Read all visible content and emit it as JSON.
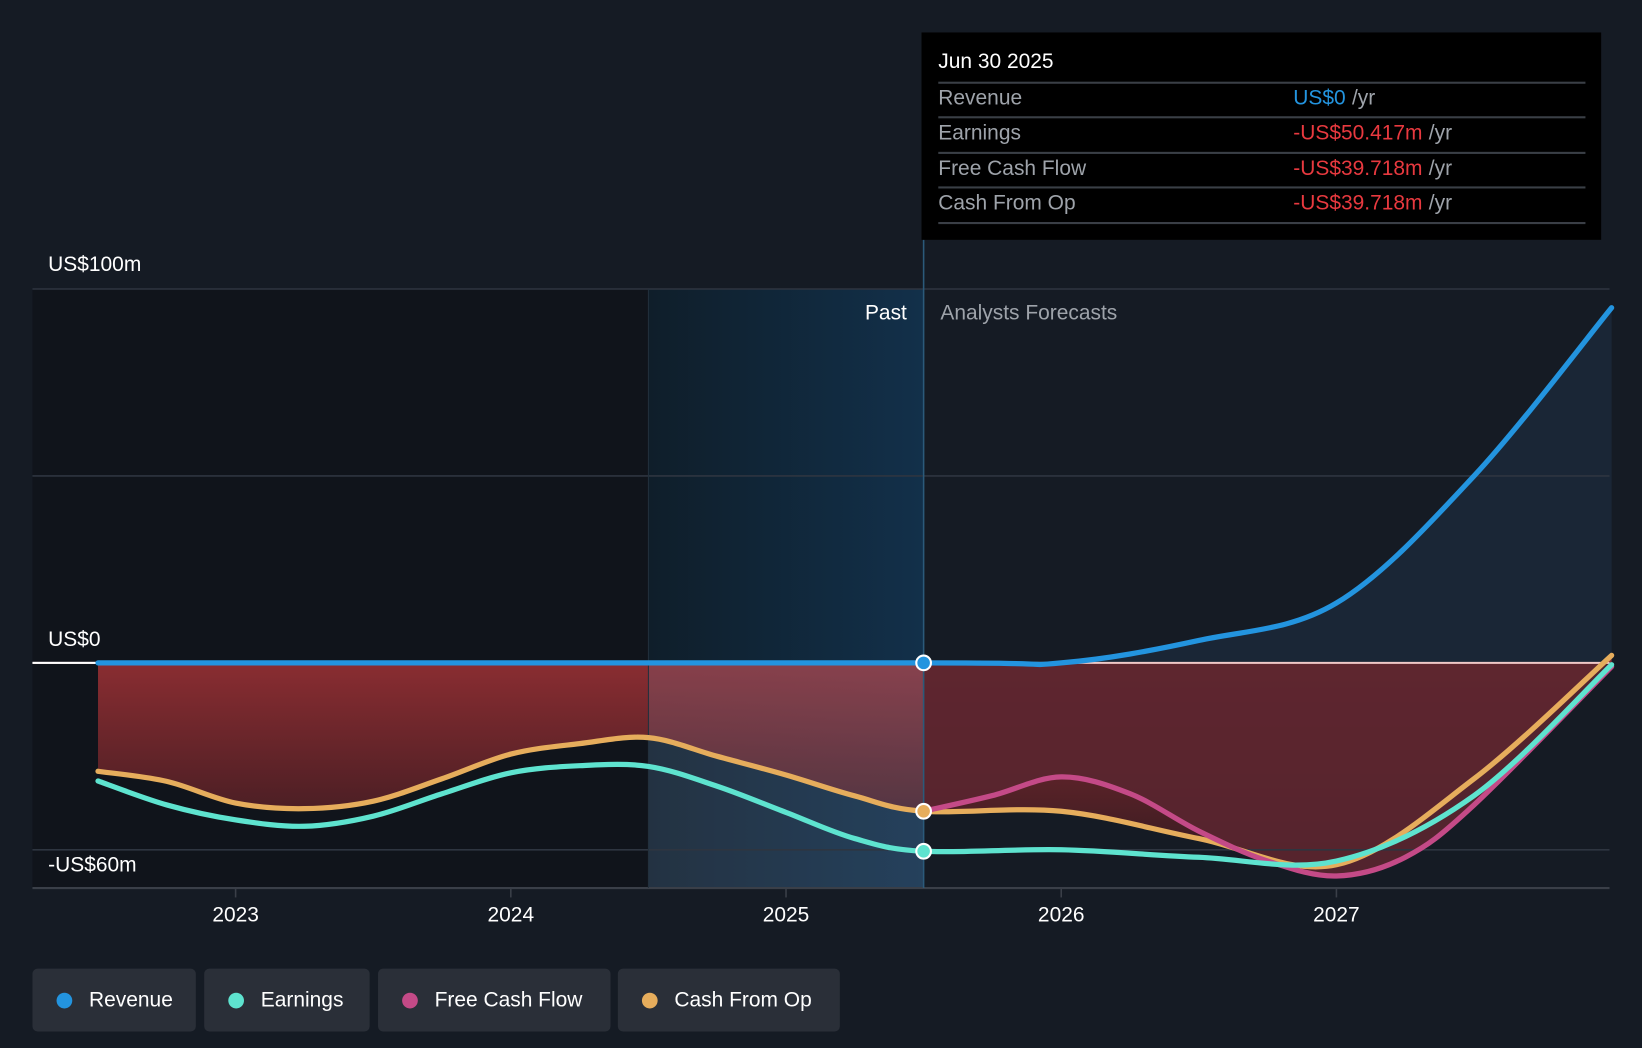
{
  "tooltip": {
    "date": "Jun 30 2025",
    "unit": "/yr",
    "rows": [
      {
        "label": "Revenue",
        "value": "US$0",
        "color": "#2394df"
      },
      {
        "label": "Earnings",
        "value": "-US$50.417m",
        "color": "#e8393f"
      },
      {
        "label": "Free Cash Flow",
        "value": "-US$39.718m",
        "color": "#e8393f"
      },
      {
        "label": "Cash From Op",
        "value": "-US$39.718m",
        "color": "#e8393f"
      }
    ]
  },
  "chart_data": {
    "type": "line",
    "ylim": [
      -60,
      100
    ],
    "xlim": [
      2022.38,
      2028
    ],
    "y_tick_labels": [
      {
        "v": 100,
        "label": "US$100m"
      },
      {
        "v": 0,
        "label": "US$0"
      },
      {
        "v": -60,
        "label": "-US$60m"
      }
    ],
    "gridlines": [
      100,
      50,
      0,
      -50
    ],
    "x_ticks": [
      2023,
      2024,
      2025,
      2026,
      2027
    ],
    "x_tick_labels": [
      "2023",
      "2024",
      "2025",
      "2026",
      "2027"
    ],
    "past_label": "Past",
    "forecast_label": "Analysts Forecasts",
    "past_end": 2025.5,
    "highlight_start": 2024.5,
    "series": [
      {
        "name": "Revenue",
        "color": "#2394df",
        "x": [
          2022.5,
          2025.5,
          2026,
          2026.5,
          2027,
          2027.5,
          2028
        ],
        "y": [
          0,
          0,
          0,
          6,
          16,
          50,
          95
        ]
      },
      {
        "name": "Earnings",
        "color": "#5ee3cf",
        "x": [
          2022.5,
          2022.75,
          2023,
          2023.25,
          2023.5,
          2023.75,
          2024,
          2024.25,
          2024.5,
          2024.75,
          2025,
          2025.25,
          2025.5,
          2026,
          2026.5,
          2027,
          2027.5,
          2028
        ],
        "y": [
          -31.6,
          -38,
          -42,
          -43.7,
          -41,
          -35,
          -29.4,
          -27.5,
          -27.7,
          -33,
          -40,
          -47,
          -50.4,
          -50,
          -52,
          -53,
          -35.5,
          -0.5
        ]
      },
      {
        "name": "Free Cash Flow",
        "color": "#c44a87",
        "x": [
          2025.5,
          2025.75,
          2026,
          2026.25,
          2026.5,
          2026.75,
          2027,
          2027.25,
          2027.5,
          2028
        ],
        "y": [
          -39.7,
          -35.5,
          -30.5,
          -35,
          -45,
          -53,
          -57,
          -52,
          -38,
          -1
        ]
      },
      {
        "name": "Cash From Op",
        "color": "#e6ad5c",
        "x": [
          2022.5,
          2022.75,
          2023,
          2023.25,
          2023.5,
          2023.75,
          2024,
          2024.25,
          2024.5,
          2024.75,
          2025,
          2025.25,
          2025.5,
          2026,
          2026.5,
          2027,
          2027.5,
          2028
        ],
        "y": [
          -29,
          -31.7,
          -37.5,
          -39,
          -37,
          -31,
          -24.4,
          -21.6,
          -20,
          -25,
          -30,
          -35.6,
          -39.7,
          -39.7,
          -47,
          -54,
          -31,
          2
        ]
      }
    ],
    "markers_at": 2025.5
  },
  "legend": [
    {
      "label": "Revenue",
      "color": "#2394df"
    },
    {
      "label": "Earnings",
      "color": "#5ee3cf"
    },
    {
      "label": "Free Cash Flow",
      "color": "#c44a87"
    },
    {
      "label": "Cash From Op",
      "color": "#e6ad5c"
    }
  ]
}
